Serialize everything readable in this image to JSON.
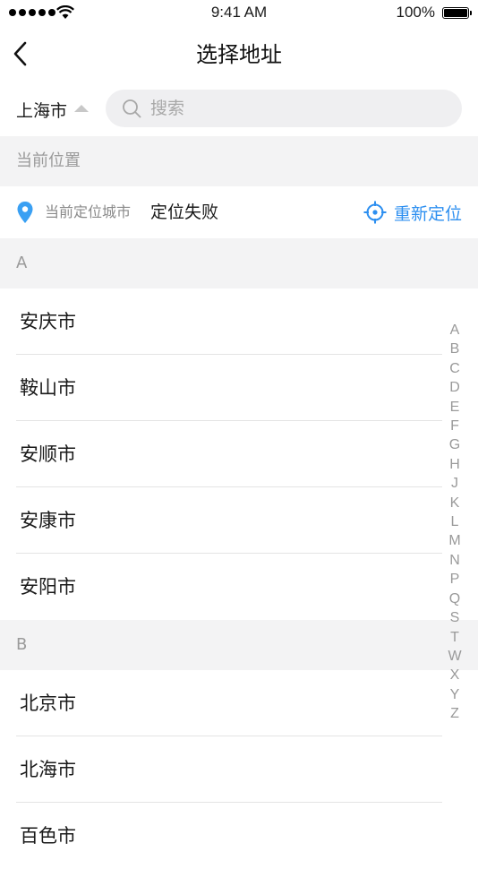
{
  "status_bar": {
    "time": "9:41 AM",
    "battery_percent": "100%",
    "battery_level": 1.0,
    "signal_bars": 5
  },
  "nav": {
    "title": "选择地址",
    "back_icon": "chevron-left-icon"
  },
  "search": {
    "city_label": "上海市",
    "placeholder": "搜索",
    "value": ""
  },
  "current_location": {
    "section_title": "当前位置",
    "label": "当前定位城市",
    "value": "定位失败",
    "relocate_label": "重新定位",
    "pin_icon": "location-pin-icon",
    "relocate_icon": "crosshair-icon"
  },
  "sections": [
    {
      "letter": "A",
      "cities": [
        "安庆市",
        "鞍山市",
        "安顺市",
        "安康市",
        "安阳市"
      ]
    },
    {
      "letter": "B",
      "cities": [
        "北京市",
        "北海市",
        "百色市"
      ]
    }
  ],
  "alphabet_index": [
    "A",
    "B",
    "C",
    "D",
    "E",
    "F",
    "G",
    "H",
    "J",
    "K",
    "L",
    "M",
    "N",
    "P",
    "Q",
    "S",
    "T",
    "W",
    "X",
    "Y",
    "Z"
  ],
  "colors": {
    "accent": "#2d8ff0",
    "section_bg": "#f3f3f4",
    "search_bg": "#efeff1",
    "muted_text": "#9a9a9a"
  }
}
